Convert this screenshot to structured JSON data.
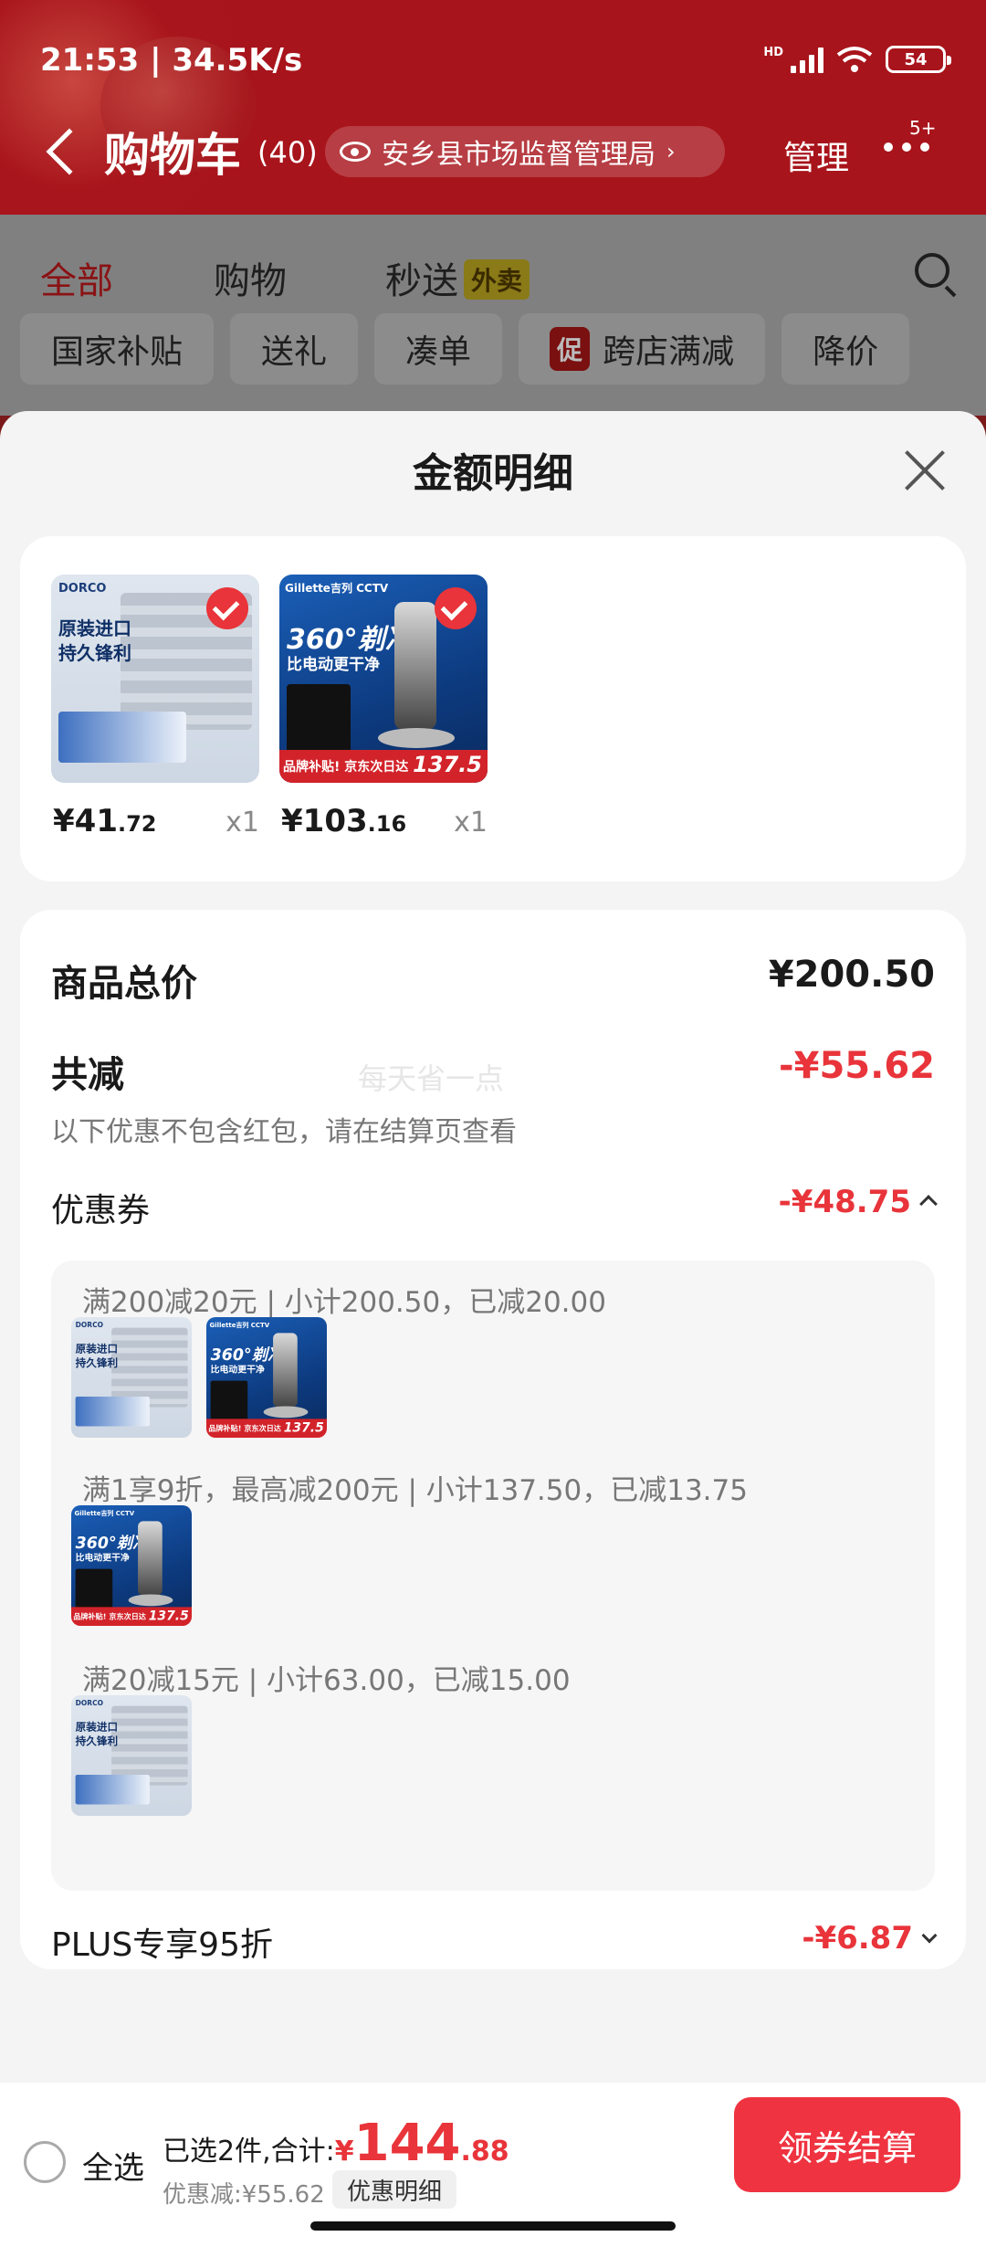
{
  "status": {
    "time": "21:53 | 34.5K/s",
    "network": "HD",
    "battery": "54"
  },
  "nav": {
    "title": "购物车",
    "count": "(40)",
    "location": "安乡县市场监督管理局",
    "manage": "管理",
    "more_badge": "5+"
  },
  "tabs": [
    {
      "label": "全部"
    },
    {
      "label": "购物"
    },
    {
      "label": "秒送"
    }
  ],
  "tab_badge": "外卖",
  "chips": [
    {
      "label": "国家补贴"
    },
    {
      "label": "送礼"
    },
    {
      "label": "凑单"
    },
    {
      "label": "跨店满减",
      "tag": "促"
    },
    {
      "label": "降价"
    }
  ],
  "sheet": {
    "title": "金额明细",
    "products": [
      {
        "price_main": "¥41",
        "price_dec": ".72",
        "qty": "x1",
        "art": {
          "brand": "DORCO",
          "line1": "原装进口",
          "line2": "持久锋利"
        }
      },
      {
        "price_main": "¥103",
        "price_dec": ".16",
        "qty": "x1",
        "art": {
          "brand": "Gillette吉列  CCTV",
          "big": "360°剃净",
          "sub": "比电动更干净",
          "bar_text": "品牌补贴! 京东次日达",
          "bar_price": "137.5"
        }
      }
    ],
    "total_label": "商品总价",
    "total_value": "¥200.50",
    "reduce_label": "共减",
    "reduce_value": "-¥55.62",
    "watermark": "每天省一点",
    "note": "以下优惠不包含红包，请在结算页查看",
    "coupon_label": "优惠券",
    "coupon_value": "-¥48.75",
    "coupon_details": [
      {
        "text": "满200减20元 | 小计200.50，已减20.00"
      },
      {
        "text": "满1享9折，最高减200元 | 小计137.50，已减13.75"
      },
      {
        "text": "满20减15元 | 小计63.00，已减15.00"
      }
    ],
    "plus_label": "PLUS专享95折",
    "plus_value": "-¥6.87"
  },
  "bottom": {
    "select_all": "全选",
    "summary_prefix": "已选2件,合计:",
    "amount_symbol": "¥",
    "amount_int": "144",
    "amount_dec": ".88",
    "discount": "优惠减:¥55.62",
    "discount_btn": "优惠明细",
    "checkout": "领券结算"
  },
  "colors": {
    "brand_red": "#a8141b",
    "price_red": "#e8343a",
    "checkout_red": "#ef3340"
  }
}
